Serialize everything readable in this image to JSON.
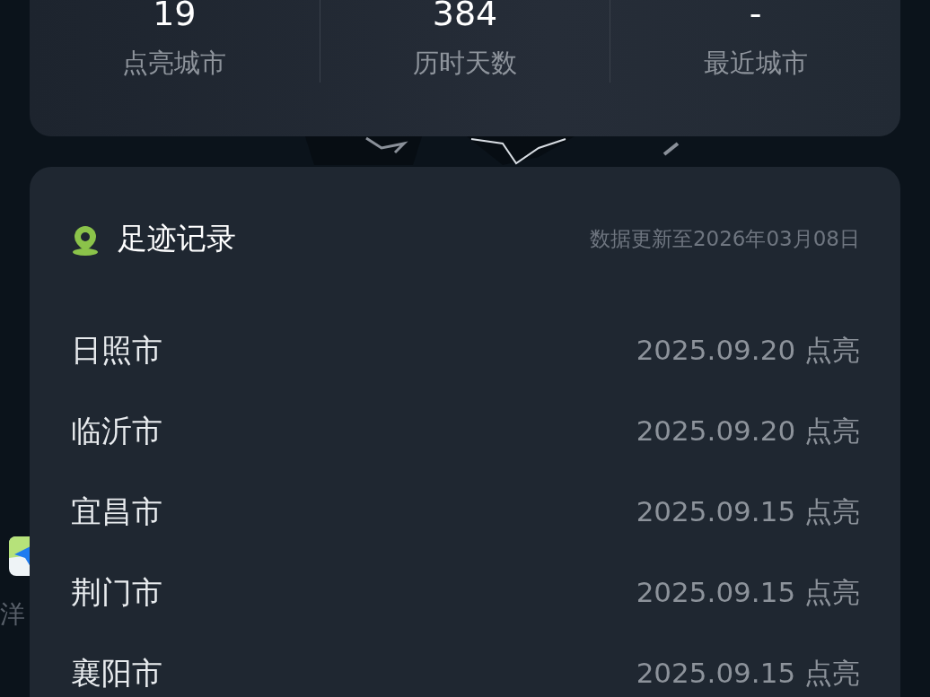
{
  "stats": [
    {
      "value": "19",
      "label": "点亮城市"
    },
    {
      "value": "384",
      "label": "历时天数"
    },
    {
      "value": "-",
      "label": "最近城市"
    }
  ],
  "map_label": "洋",
  "records": {
    "title": "足迹记录",
    "updated": "数据更新至2026年03月08日",
    "items": [
      {
        "city": "日照市",
        "date": "2025.09.20 点亮"
      },
      {
        "city": "临沂市",
        "date": "2025.09.20 点亮"
      },
      {
        "city": "宜昌市",
        "date": "2025.09.15 点亮"
      },
      {
        "city": "荆门市",
        "date": "2025.09.15 点亮"
      },
      {
        "city": "襄阳市",
        "date": "2025.09.15 点亮"
      }
    ]
  }
}
